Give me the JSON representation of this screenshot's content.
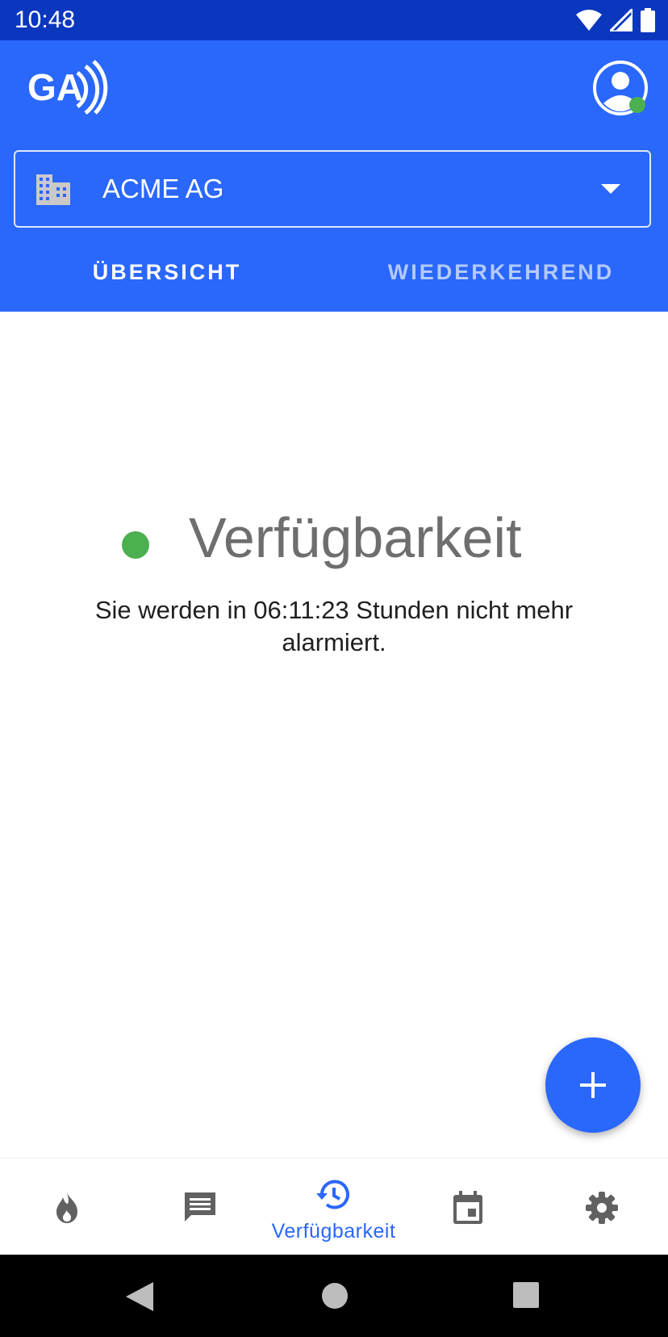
{
  "status_bar": {
    "time": "10:48"
  },
  "app_bar": {
    "logo_text": "GA",
    "profile_status_color": "#4caf50"
  },
  "org_selector": {
    "selected": "ACME AG"
  },
  "tabs": [
    {
      "label": "ÜBERSICHT",
      "active": true
    },
    {
      "label": "WIEDERKEHREND",
      "active": false
    }
  ],
  "availability": {
    "title": "Verfügbarkeit",
    "status_color": "#4caf50",
    "message": "Sie werden in 06:11:23 Stunden nicht mehr alarmiert."
  },
  "fab": {
    "icon": "plus-icon"
  },
  "bottom_nav": {
    "items": [
      {
        "icon": "flame-icon",
        "label": "",
        "active": false
      },
      {
        "icon": "message-icon",
        "label": "",
        "active": false
      },
      {
        "icon": "history-icon",
        "label": "Verfügbarkeit",
        "active": true
      },
      {
        "icon": "calendar-icon",
        "label": "",
        "active": false
      },
      {
        "icon": "gear-icon",
        "label": "",
        "active": false
      }
    ]
  },
  "colors": {
    "primary": "#2a67fb",
    "status_bar": "#0b37bf",
    "accent_green": "#4caf50",
    "icon_gray": "#616161"
  }
}
